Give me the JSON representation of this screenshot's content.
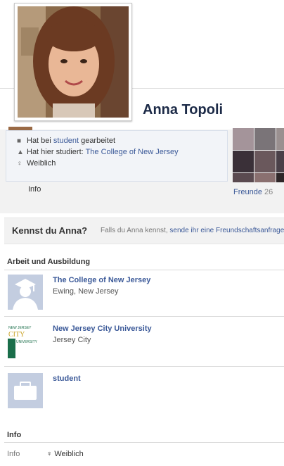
{
  "profile": {
    "name": "Anna Topoli"
  },
  "about": {
    "work_prefix": "Hat bei",
    "work_link": "student",
    "work_suffix": "gearbeitet",
    "study_prefix": "Hat hier studiert:",
    "study_link": "The College of New Jersey",
    "gender": "Weiblich"
  },
  "tabs": {
    "info": "Info"
  },
  "friends": {
    "label": "Freunde",
    "count": "26"
  },
  "know": {
    "title": "Kennst du Anna?",
    "text": "Falls du Anna kennst,",
    "link": "sende ihr eine Freundschaftsanfrage"
  },
  "work_education": {
    "heading": "Arbeit und Ausbildung",
    "entries": [
      {
        "title": "The College of New Jersey",
        "sub": "Ewing, New Jersey",
        "icon": "graduate-silhouette-icon"
      },
      {
        "title": "New Jersey City University",
        "sub": "Jersey City",
        "icon": "njcu-logo",
        "logo_text_top": "NEW JERSEY",
        "logo_text_mid": "CITY",
        "logo_text_bottom": "UNIVERSITY"
      },
      {
        "title": "student",
        "sub": "",
        "icon": "briefcase-icon"
      }
    ]
  },
  "info_section": {
    "heading": "Info",
    "label": "Info",
    "value": "Weiblich"
  },
  "colors": {
    "link": "#3b5998",
    "name": "#1c2a47",
    "njcu_green": "#1a6e4a",
    "njcu_gold": "#c8a020",
    "placeholder": "#c3cde0"
  }
}
